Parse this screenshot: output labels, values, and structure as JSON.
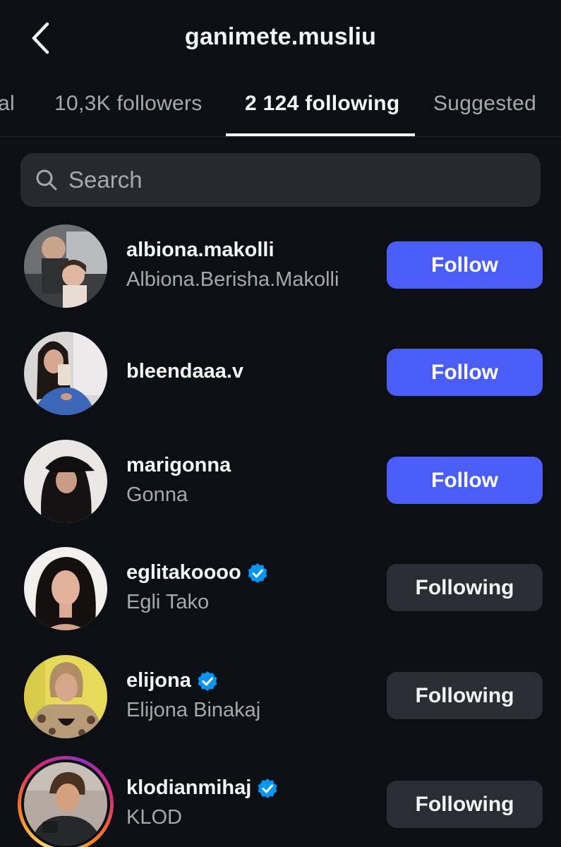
{
  "header": {
    "title": "ganimete.musliu",
    "back_icon": "chevron-left-icon"
  },
  "tabs": [
    {
      "label": "al",
      "active": false
    },
    {
      "label": "10,3K followers",
      "active": false
    },
    {
      "label": "2 124 following",
      "active": true
    },
    {
      "label": "Suggested",
      "active": false
    }
  ],
  "search": {
    "placeholder": "Search",
    "value": "",
    "icon": "search-icon"
  },
  "colors": {
    "background": "#0c1014",
    "follow_button": "#4a5df9",
    "following_button": "#2a2d33",
    "verified_badge": "#0095f6",
    "secondary_text": "#a8a8a8"
  },
  "list": [
    {
      "username": "albiona.makolli",
      "fullname": "Albiona.Berisha.Makolli",
      "verified": false,
      "button": "Follow",
      "story": false
    },
    {
      "username": "bleendaaa.v",
      "fullname": "",
      "verified": false,
      "button": "Follow",
      "story": false
    },
    {
      "username": "marigonna",
      "fullname": "Gonna",
      "verified": false,
      "button": "Follow",
      "story": false
    },
    {
      "username": "eglitakoooo",
      "fullname": "Egli Tako",
      "verified": true,
      "button": "Following",
      "story": false
    },
    {
      "username": "elijona",
      "fullname": "Elijona Binakaj",
      "verified": true,
      "button": "Following",
      "story": false
    },
    {
      "username": "klodianmihaj",
      "fullname": "KLOD",
      "verified": true,
      "button": "Following",
      "story": true
    }
  ]
}
